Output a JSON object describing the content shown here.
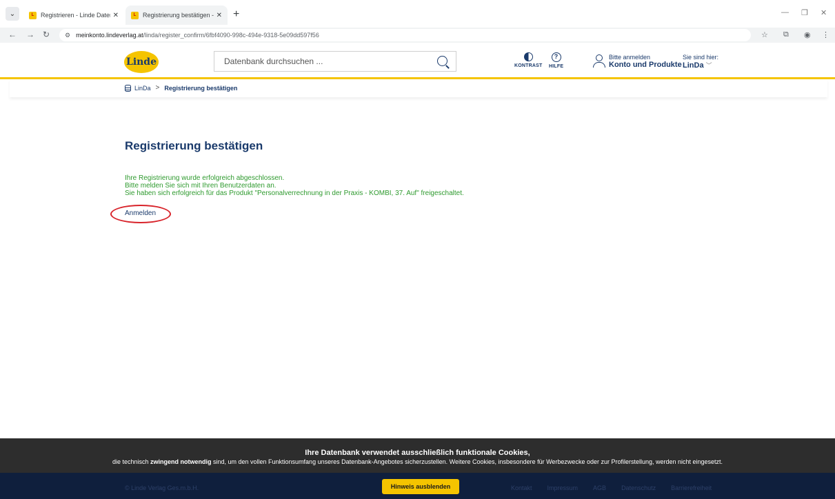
{
  "browser": {
    "tabs": [
      {
        "title": "Registrieren - Linde Datenbank"
      },
      {
        "title": "Registrierung bestätigen - Linde"
      }
    ],
    "url_host": "meinkonto.lindeverlag.at",
    "url_path": "/linda/register_confirm/6fbf4090-998c-494e-9318-5e09dd597f56"
  },
  "header": {
    "logo_text": "Linde",
    "search_placeholder": "Datenbank durchsuchen ...",
    "contrast_label": "KONTRAST",
    "help_label": "HILFE",
    "login_small": "Bitte anmelden",
    "login_big": "Konto und Produkte",
    "location_small": "Sie sind hier:",
    "location_big": "LinDa"
  },
  "breadcrumb": {
    "root": "LinDa",
    "current": "Registrierung bestätigen"
  },
  "main": {
    "title": "Registrierung bestätigen",
    "messages": [
      "Ihre Registrierung wurde erfolgreich abgeschlossen.",
      "Bitte melden Sie sich mit Ihren Benutzerdaten an.",
      "Sie haben sich erfolgreich für das Produkt \"Personalverrechnung in der Praxis - KOMBI, 37. Auf\" freigeschaltet."
    ],
    "login_link": "Anmelden"
  },
  "cookie": {
    "title": "Ihre Datenbank verwendet ausschließlich funktionale Cookies,",
    "text_before": "die technisch ",
    "text_bold": "zwingend notwendig",
    "text_after": " sind, um den vollen Funktionsumfang unseres Datenbank-Angebotes sicherzustellen. Weitere Cookies, insbesondere für Werbezwecke oder zur Profilerstellung, werden nicht eingesetzt.",
    "button": "Hinweis ausblenden"
  },
  "footer": {
    "copyright": "© Linde Verlag Ges.m.b.H.",
    "links": [
      "Kontakt",
      "Impressum",
      "AGB",
      "Datenschutz",
      "Barrierefreiheit"
    ]
  },
  "colors": {
    "brand_yellow": "#f5c400",
    "brand_blue": "#1a3a6b",
    "success_green": "#2e9a2e",
    "annotation_red": "#d8232a"
  }
}
